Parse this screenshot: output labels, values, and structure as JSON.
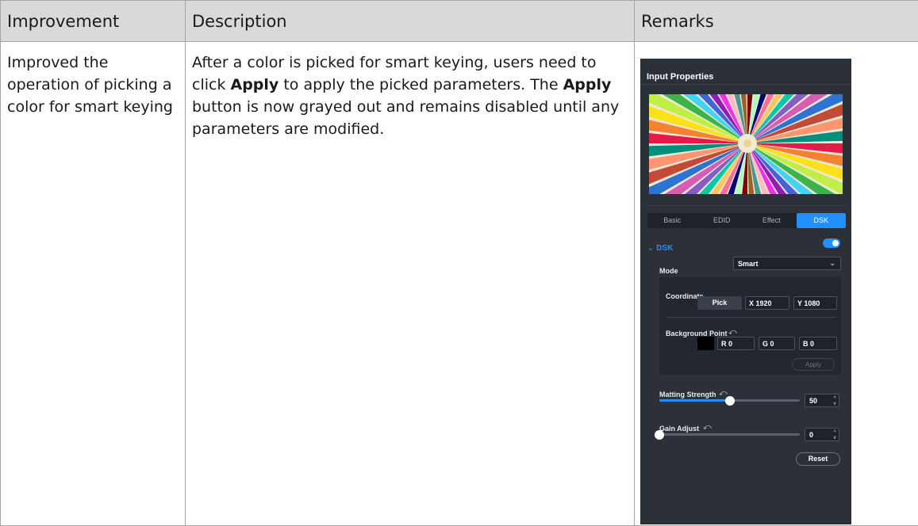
{
  "table": {
    "headers": [
      "Improvement",
      "Description",
      "Remarks"
    ],
    "row": {
      "improvement": "Improved the operation of picking a color for smart keying",
      "description_parts": {
        "p1": "After a color is picked for smart keying, users need to click ",
        "b1": "Apply",
        "p2": " to apply the picked parameters. The ",
        "b2": "Apply",
        "p3": " button is now grayed out and remains disabled until any parameters are modified."
      }
    }
  },
  "panel": {
    "title": "Input Properties",
    "tabs": [
      "Basic",
      "EDID",
      "Effect",
      "DSK"
    ],
    "active_tab": "DSK",
    "section": "DSK",
    "dsk_enabled": true,
    "mode_label": "Mode",
    "mode_value": "Smart",
    "coordinate_label": "Coordinate",
    "pick_label": "Pick",
    "x_field": "X  1920",
    "y_field": "Y  1080",
    "background_point_label": "Background Point",
    "r_field": "R  0",
    "g_field": "G  0",
    "b_field": "B  0",
    "apply_label": "Apply",
    "matting_label": "Matting Strength",
    "matting_value": "50",
    "matting_level": 0.5,
    "gain_label": "Gain Adjust",
    "gain_value": "0",
    "gain_level": 0,
    "reset_label": "Reset",
    "colors": {
      "panel_bg": "#2b3039",
      "accent": "#1e90ff"
    }
  }
}
